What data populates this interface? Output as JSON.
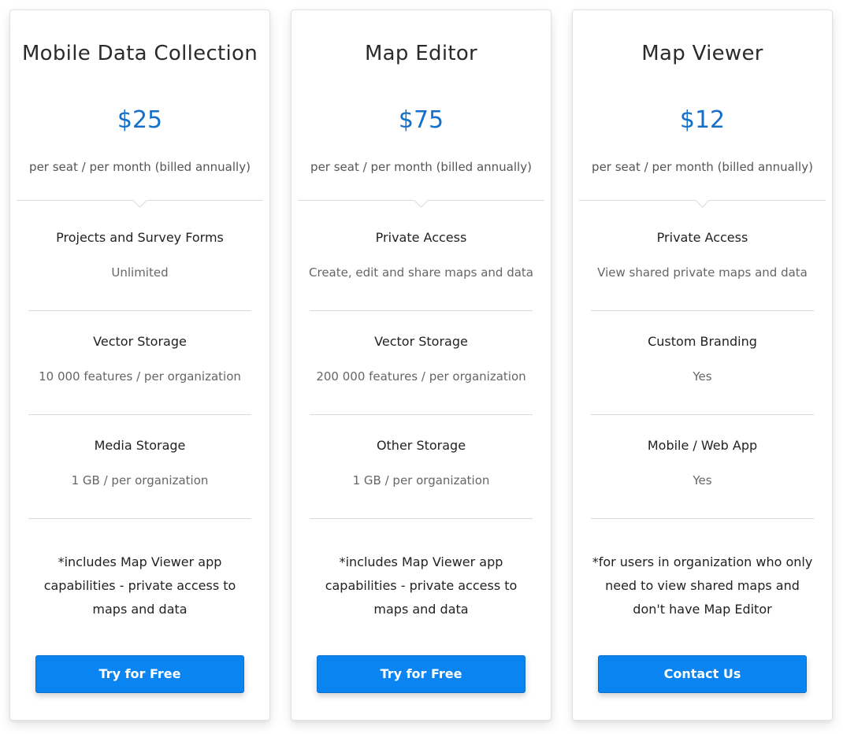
{
  "colors": {
    "price": "#1470c8",
    "button": "#0a84f0",
    "divider": "#dcdcdc"
  },
  "plans": [
    {
      "title": "Mobile Data Collection",
      "price": "$25",
      "price_note": "per seat / per month (billed annually)",
      "features": [
        {
          "name": "Projects and Survey Forms",
          "value": "Unlimited"
        },
        {
          "name": "Vector Storage",
          "value": "10 000 features / per organization"
        },
        {
          "name": "Media Storage",
          "value": "1 GB / per organization"
        }
      ],
      "footnote": "*includes Map Viewer app capabilities - private access to maps and data",
      "cta": "Try for Free"
    },
    {
      "title": "Map Editor",
      "price": "$75",
      "price_note": "per seat / per month (billed annually)",
      "features": [
        {
          "name": "Private Access",
          "value": "Create, edit and share maps and data"
        },
        {
          "name": "Vector Storage",
          "value": "200 000 features / per organization"
        },
        {
          "name": "Other Storage",
          "value": "1 GB / per organization"
        }
      ],
      "footnote": "*includes Map Viewer app capabilities - private access to maps and data",
      "cta": "Try for Free"
    },
    {
      "title": "Map Viewer",
      "price": "$12",
      "price_note": "per seat / per month (billed annually)",
      "features": [
        {
          "name": "Private Access",
          "value": "View shared private maps and data"
        },
        {
          "name": "Custom Branding",
          "value": "Yes"
        },
        {
          "name": "Mobile / Web App",
          "value": "Yes"
        }
      ],
      "footnote": "*for users in organization who only need to view shared maps and don't have Map Editor",
      "cta": "Contact Us"
    }
  ]
}
